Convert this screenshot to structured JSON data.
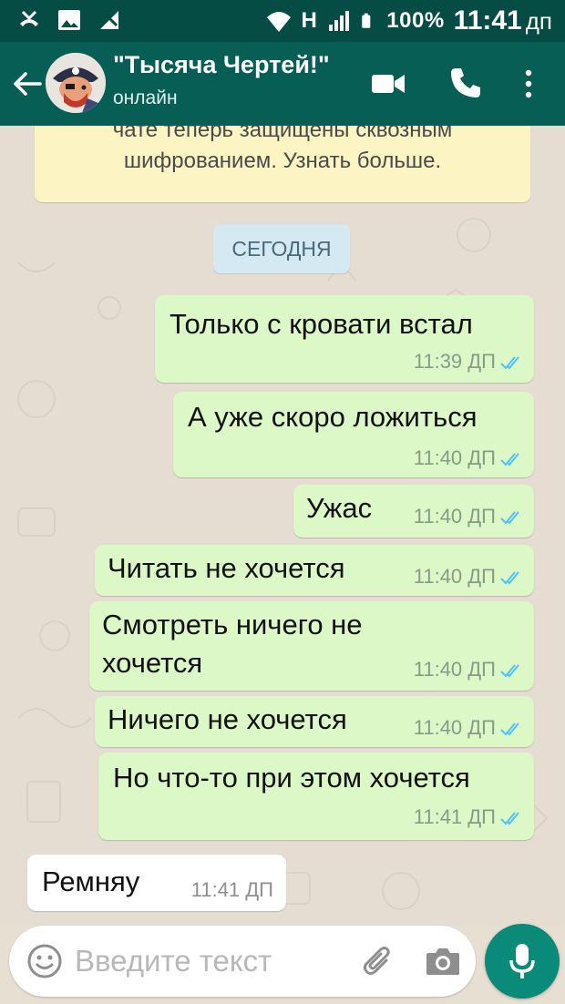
{
  "status_bar": {
    "network": "H",
    "battery": "100%",
    "time": "11:41",
    "ampm": "дп"
  },
  "chat_header": {
    "title": "\"Тысяча Чертей!\"",
    "status": "онлайн"
  },
  "encryption_notice": {
    "line1": "чате теперь защищены сквозным",
    "line2": "шифрованием. Узнать больше."
  },
  "date_label": "СЕГОДНЯ",
  "messages": [
    {
      "text": "Только с кровати встал",
      "time": "11:39 ДП",
      "direction": "out",
      "read": true
    },
    {
      "text": "А уже скоро ложиться",
      "time": "11:40 ДП",
      "direction": "out",
      "read": true
    },
    {
      "text": "Ужас",
      "time": "11:40 ДП",
      "direction": "out",
      "read": true
    },
    {
      "text": "Читать не хочется",
      "time": "11:40 ДП",
      "direction": "out",
      "read": true
    },
    {
      "text": "Смотреть ничего не",
      "text2": "хочется",
      "time": "11:40 ДП",
      "direction": "out",
      "read": true
    },
    {
      "text": "Ничего не хочется",
      "time": "11:40 ДП",
      "direction": "out",
      "read": true
    },
    {
      "text": "Но что-то при этом хочется",
      "time": "11:41 ДП",
      "direction": "out",
      "read": true
    },
    {
      "text": "Ремняу",
      "time": "11:41 ДП",
      "direction": "in"
    }
  ],
  "composer": {
    "placeholder": "Введите текст"
  },
  "colors": {
    "header": "#075e54",
    "status_bar": "#054d44",
    "outgoing_bubble": "#dcf8c6",
    "incoming_bubble": "#ffffff",
    "read_ticks": "#4fc3f7",
    "mic_button": "#0a8a78"
  },
  "icons": [
    "back-arrow-icon",
    "avatar",
    "video-call-icon",
    "phone-icon",
    "more-vert-icon",
    "emoji-icon",
    "attach-icon",
    "camera-icon",
    "mic-icon",
    "read-ticks-icon"
  ]
}
